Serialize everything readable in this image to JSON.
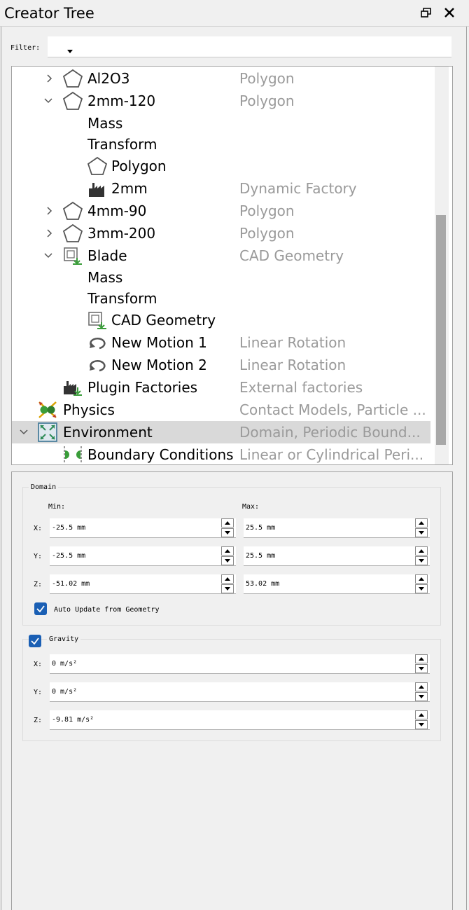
{
  "window": {
    "title": "Creator Tree"
  },
  "filter": {
    "label": "Filter:",
    "value": ""
  },
  "tree": {
    "rows": [
      {
        "name": "Al2O3",
        "type": "Polygon",
        "icon": "polygon-icon",
        "chevron": "collapsed"
      },
      {
        "name": "2mm-120",
        "type": "Polygon",
        "icon": "polygon-icon",
        "chevron": "expanded"
      },
      {
        "name": "Mass",
        "type": "",
        "icon": "",
        "chevron": ""
      },
      {
        "name": "Transform",
        "type": "",
        "icon": "",
        "chevron": ""
      },
      {
        "name": "Polygon",
        "type": "",
        "icon": "polygon-icon",
        "chevron": ""
      },
      {
        "name": "2mm",
        "type": "Dynamic Factory",
        "icon": "factory-icon",
        "chevron": ""
      },
      {
        "name": "4mm-90",
        "type": "Polygon",
        "icon": "polygon-icon",
        "chevron": "collapsed"
      },
      {
        "name": "3mm-200",
        "type": "Polygon",
        "icon": "polygon-icon",
        "chevron": "collapsed"
      },
      {
        "name": "Blade",
        "type": "CAD Geometry",
        "icon": "cad-geometry-icon",
        "chevron": "expanded"
      },
      {
        "name": "Mass",
        "type": "",
        "icon": "",
        "chevron": ""
      },
      {
        "name": "Transform",
        "type": "",
        "icon": "",
        "chevron": ""
      },
      {
        "name": "CAD Geometry",
        "type": "",
        "icon": "cad-geometry-icon",
        "chevron": ""
      },
      {
        "name": "New Motion 1",
        "type": "Linear Rotation",
        "icon": "rotation-icon",
        "chevron": ""
      },
      {
        "name": "New Motion 2",
        "type": "Linear Rotation",
        "icon": "rotation-icon",
        "chevron": ""
      },
      {
        "name": "Plugin Factories",
        "type": "External factories",
        "icon": "plugin-factory-icon",
        "chevron": ""
      },
      {
        "name": "Physics",
        "type": "Contact Models, Particle ...",
        "icon": "physics-icon",
        "chevron": ""
      },
      {
        "name": "Environment",
        "type": "Domain, Periodic Bound...",
        "icon": "environment-icon",
        "chevron": "expanded"
      },
      {
        "name": "Boundary Conditions",
        "type": "Linear or Cylindrical Peri...",
        "icon": "boundary-conditions-icon",
        "chevron": ""
      }
    ],
    "selected": "Environment"
  },
  "domain": {
    "legend": "Domain",
    "min_label": "Min:",
    "max_label": "Max:",
    "x_label": "X:",
    "y_label": "Y:",
    "z_label": "Z:",
    "x_min": "-25.5 mm",
    "x_max": "25.5 mm",
    "y_min": "-25.5 mm",
    "y_max": "25.5 mm",
    "z_min": "-51.02 mm",
    "z_max": "53.02 mm",
    "auto_update_label": "Auto Update from Geometry",
    "auto_update_checked": true
  },
  "gravity": {
    "legend": "Gravity",
    "enabled": true,
    "x_label": "X:",
    "y_label": "Y:",
    "z_label": "Z:",
    "x": "0 m/s²",
    "y": "0 m/s²",
    "z": "-9.81 m/s²"
  },
  "colors": {
    "accent": "#1a5fb4",
    "muted_text": "#9a9a9a",
    "selection": "#d9d9d9"
  }
}
